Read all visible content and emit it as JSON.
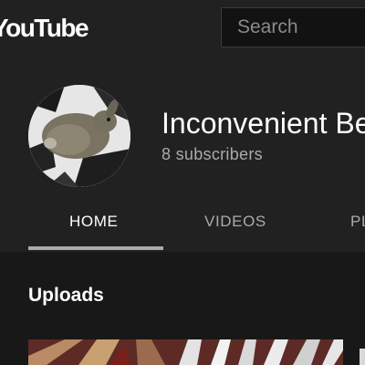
{
  "topbar": {
    "logo_text": "YouTube",
    "search": {
      "placeholder": "Search",
      "value": ""
    }
  },
  "channel": {
    "name": "Inconvenient Be",
    "subscribers": "8 subscribers"
  },
  "tabs": [
    {
      "label": "HOME",
      "active": true
    },
    {
      "label": "VIDEOS",
      "active": false
    },
    {
      "label": "PL",
      "active": false
    }
  ],
  "content": {
    "section_title": "Uploads"
  },
  "colors": {
    "topbar_bg": "#212121",
    "page_bg": "#181818",
    "tab_underline": "#aaaaaa"
  }
}
